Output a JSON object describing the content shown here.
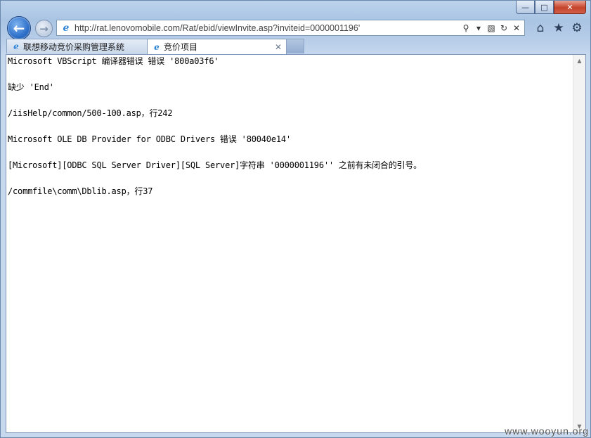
{
  "window": {
    "minimize_glyph": "—",
    "maximize_glyph": "□",
    "close_glyph": "✕"
  },
  "nav": {
    "back_glyph": "←",
    "forward_glyph": "→"
  },
  "address": {
    "url": "http://rat.lenovomobile.com/Rat/ebid/viewInvite.asp?inviteid=0000001196'",
    "icons": [
      "search-icon",
      "dropdown-icon",
      "compat-icon",
      "refresh-icon",
      "stop-icon"
    ]
  },
  "toolbar_icons": [
    "home-icon",
    "favorites-icon",
    "tools-icon"
  ],
  "tabs": [
    {
      "label": "联想移动竞价采购管理系统",
      "active": false
    },
    {
      "label": "竞价项目",
      "active": true
    }
  ],
  "page": {
    "lines": [
      "Microsoft VBScript 编译器错误 错误 '800a03f6'",
      "缺少 'End'",
      "/iisHelp/common/500-100.asp，行242",
      "Microsoft OLE DB Provider for ODBC Drivers 错误 '80040e14'",
      "[Microsoft][ODBC SQL Server Driver][SQL Server]字符串 '0000001196'' 之前有未闭合的引号。",
      "/commfile\\comm\\Dblib.asp，行37"
    ]
  },
  "watermark": "www.wooyun.org"
}
